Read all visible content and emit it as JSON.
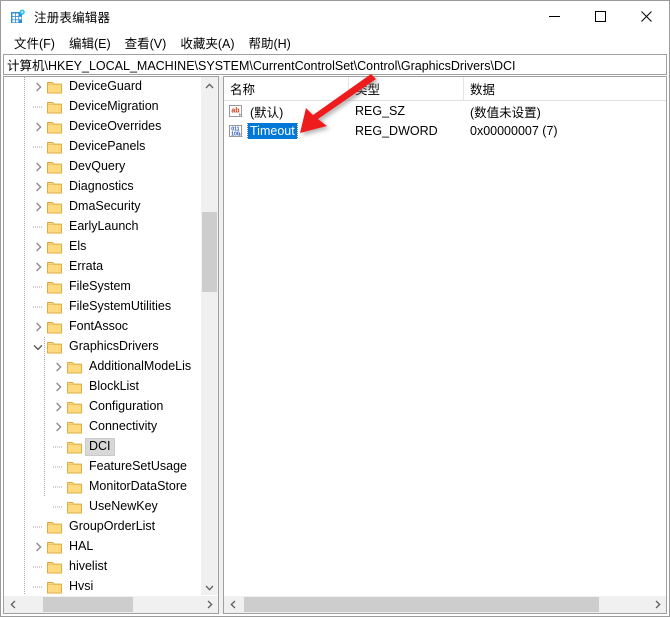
{
  "window": {
    "title": "注册表编辑器",
    "app_icon": "registry-editor-icon",
    "minimize_label": "—",
    "maximize_label": "□",
    "close_label": "✕"
  },
  "menubar": {
    "items": [
      {
        "label": "文件(F)",
        "name": "menu-file"
      },
      {
        "label": "编辑(E)",
        "name": "menu-edit"
      },
      {
        "label": "查看(V)",
        "name": "menu-view"
      },
      {
        "label": "收藏夹(A)",
        "name": "menu-favorites"
      },
      {
        "label": "帮助(H)",
        "name": "menu-help"
      }
    ]
  },
  "address": {
    "path": "计算机\\HKEY_LOCAL_MACHINE\\SYSTEM\\CurrentControlSet\\Control\\GraphicsDrivers\\DCI"
  },
  "tree": {
    "items": [
      {
        "label": "DeviceGuard",
        "depth": 1,
        "expandable": true,
        "expanded": false,
        "selected": false
      },
      {
        "label": "DeviceMigration",
        "depth": 1,
        "expandable": false,
        "expanded": false,
        "selected": false
      },
      {
        "label": "DeviceOverrides",
        "depth": 1,
        "expandable": true,
        "expanded": false,
        "selected": false
      },
      {
        "label": "DevicePanels",
        "depth": 1,
        "expandable": false,
        "expanded": false,
        "selected": false
      },
      {
        "label": "DevQuery",
        "depth": 1,
        "expandable": true,
        "expanded": false,
        "selected": false
      },
      {
        "label": "Diagnostics",
        "depth": 1,
        "expandable": true,
        "expanded": false,
        "selected": false
      },
      {
        "label": "DmaSecurity",
        "depth": 1,
        "expandable": true,
        "expanded": false,
        "selected": false
      },
      {
        "label": "EarlyLaunch",
        "depth": 1,
        "expandable": false,
        "expanded": false,
        "selected": false
      },
      {
        "label": "Els",
        "depth": 1,
        "expandable": true,
        "expanded": false,
        "selected": false
      },
      {
        "label": "Errata",
        "depth": 1,
        "expandable": true,
        "expanded": false,
        "selected": false
      },
      {
        "label": "FileSystem",
        "depth": 1,
        "expandable": false,
        "expanded": false,
        "selected": false
      },
      {
        "label": "FileSystemUtilities",
        "depth": 1,
        "expandable": false,
        "expanded": false,
        "selected": false
      },
      {
        "label": "FontAssoc",
        "depth": 1,
        "expandable": true,
        "expanded": false,
        "selected": false
      },
      {
        "label": "GraphicsDrivers",
        "depth": 1,
        "expandable": true,
        "expanded": true,
        "selected": false
      },
      {
        "label": "AdditionalModeLis",
        "depth": 2,
        "expandable": true,
        "expanded": false,
        "selected": false
      },
      {
        "label": "BlockList",
        "depth": 2,
        "expandable": true,
        "expanded": false,
        "selected": false
      },
      {
        "label": "Configuration",
        "depth": 2,
        "expandable": true,
        "expanded": false,
        "selected": false
      },
      {
        "label": "Connectivity",
        "depth": 2,
        "expandable": true,
        "expanded": false,
        "selected": false
      },
      {
        "label": "DCI",
        "depth": 2,
        "expandable": false,
        "expanded": false,
        "selected": true
      },
      {
        "label": "FeatureSetUsage",
        "depth": 2,
        "expandable": false,
        "expanded": false,
        "selected": false
      },
      {
        "label": "MonitorDataStore",
        "depth": 2,
        "expandable": false,
        "expanded": false,
        "selected": false
      },
      {
        "label": "UseNewKey",
        "depth": 2,
        "expandable": false,
        "expanded": false,
        "selected": false
      },
      {
        "label": "GroupOrderList",
        "depth": 1,
        "expandable": false,
        "expanded": false,
        "selected": false
      },
      {
        "label": "HAL",
        "depth": 1,
        "expandable": true,
        "expanded": false,
        "selected": false
      },
      {
        "label": "hivelist",
        "depth": 1,
        "expandable": false,
        "expanded": false,
        "selected": false
      },
      {
        "label": "Hvsi",
        "depth": 1,
        "expandable": false,
        "expanded": false,
        "selected": false
      }
    ]
  },
  "list": {
    "columns": [
      {
        "label": "名称",
        "name": "column-name"
      },
      {
        "label": "类型",
        "name": "column-type"
      },
      {
        "label": "数据",
        "name": "column-data"
      }
    ],
    "rows": [
      {
        "name": "(默认)",
        "type": "REG_SZ",
        "data": "(数值未设置)",
        "icon": "string-value-icon",
        "selected": false
      },
      {
        "name": "Timeout",
        "type": "REG_DWORD",
        "data": "0x00000007 (7)",
        "icon": "dword-value-icon",
        "selected": true
      }
    ]
  },
  "annotation": {
    "arrow_color": "#ee1c1c",
    "arrow_name": "red-pointer-arrow"
  },
  "colors": {
    "selection_blue": "#0078d7",
    "tree_selection_gray": "#d8d8d8",
    "folder_yellow": "#ffd77a",
    "accent_red": "#ee1c1c"
  }
}
